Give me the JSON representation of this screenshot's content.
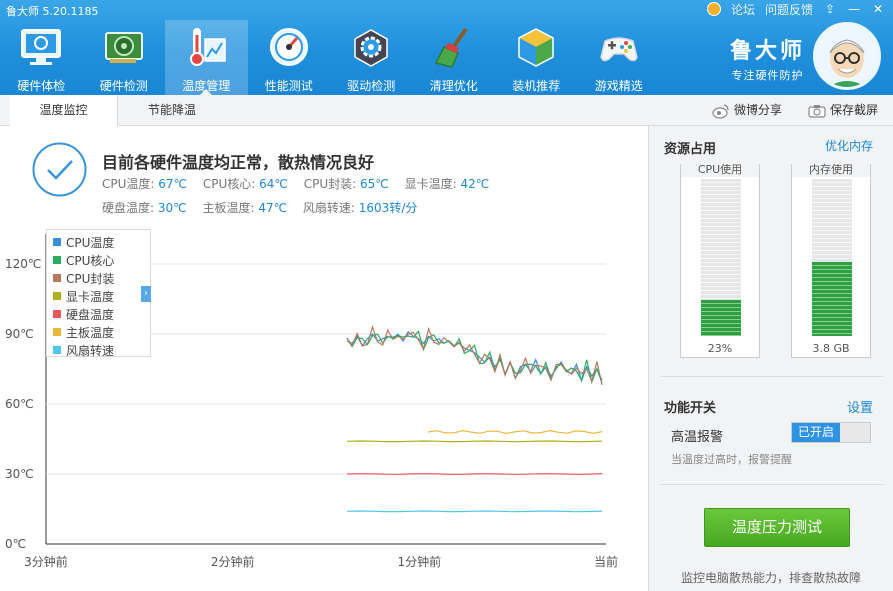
{
  "app": {
    "title": "鲁大师 5.20.1185"
  },
  "toplinks": {
    "forum": "论坛",
    "feedback": "问题反馈",
    "minimize": "—",
    "close": "✕"
  },
  "nav": [
    {
      "label": "硬件体检",
      "icon": "monitor-icon"
    },
    {
      "label": "硬件检测",
      "icon": "graphics-card-icon"
    },
    {
      "label": "温度管理",
      "icon": "thermometer-icon"
    },
    {
      "label": "性能测试",
      "icon": "speedometer-icon"
    },
    {
      "label": "驱动检测",
      "icon": "gear-box-icon"
    },
    {
      "label": "清理优化",
      "icon": "broom-icon"
    },
    {
      "label": "装机推荐",
      "icon": "cube-icon"
    },
    {
      "label": "游戏精选",
      "icon": "gamepad-icon"
    }
  ],
  "brand": {
    "name": "鲁大师",
    "slogan": "专注硬件防护"
  },
  "tabs": {
    "monitor": "温度监控",
    "cooling": "节能降温",
    "share": "微博分享",
    "screenshot": "保存截屏"
  },
  "status": {
    "title": "目前各硬件温度均正常，散热情况良好",
    "cpu_temp_label": "CPU温度:",
    "cpu_temp": "67℃",
    "cpu_core_label": "CPU核心:",
    "cpu_core": "64℃",
    "cpu_pkg_label": "CPU封装:",
    "cpu_pkg": "65℃",
    "gpu_temp_label": "显卡温度:",
    "gpu_temp": "42℃",
    "disk_temp_label": "硬盘温度:",
    "disk_temp": "30℃",
    "board_temp_label": "主板温度:",
    "board_temp": "47℃",
    "fan_label": "风扇转速:",
    "fan": "1603转/分"
  },
  "chart_data": {
    "type": "line",
    "y_ticks": [
      "120℃",
      "90℃",
      "60℃",
      "30℃",
      "0℃"
    ],
    "ylim": [
      0,
      120
    ],
    "x_ticks": [
      "3分钟前",
      "2分钟前",
      "1分钟前",
      "当前"
    ],
    "grid": true,
    "legend_position": "top-left",
    "series": [
      {
        "name": "CPU温度",
        "color": "#3a8fd8"
      },
      {
        "name": "CPU核心",
        "color": "#2eaa63"
      },
      {
        "name": "CPU封装",
        "color": "#b4785c"
      },
      {
        "name": "显卡温度",
        "color": "#a8b41e",
        "values": [
          44,
          44
        ]
      },
      {
        "name": "硬盘温度",
        "color": "#e85757",
        "values": [
          30,
          30
        ]
      },
      {
        "name": "主板温度",
        "color": "#e8b93c",
        "values": [
          48,
          48
        ]
      },
      {
        "name": "风扇转速",
        "color": "#50c7e8",
        "values": [
          14,
          14
        ]
      }
    ],
    "cpu_trace": [
      87,
      86,
      89,
      85,
      88,
      90,
      87,
      88,
      89,
      88,
      90,
      87,
      91,
      89,
      88,
      86,
      89,
      87,
      88,
      86,
      87,
      85,
      86,
      84,
      83,
      82,
      80,
      78,
      80,
      76,
      79,
      73,
      78,
      71,
      76,
      77,
      74,
      79,
      73,
      76,
      72,
      75,
      78,
      74,
      73,
      77,
      70,
      76,
      72,
      75,
      69
    ]
  },
  "resources": {
    "title": "资源占用",
    "optimize": "优化内存",
    "cpu": {
      "label": "CPU使用",
      "value": "23%",
      "fraction": 0.23
    },
    "mem": {
      "label": "内存使用",
      "value": "3.8 GB",
      "fraction": 0.47
    }
  },
  "functions": {
    "title": "功能开关",
    "settings": "设置",
    "alarm_label": "高温报警",
    "alarm_state": "已开启",
    "alarm_desc": "当温度过高时，报警提醒"
  },
  "stress": {
    "button": "温度压力测试",
    "desc": "监控电脑散热能力，排查散热故障"
  }
}
